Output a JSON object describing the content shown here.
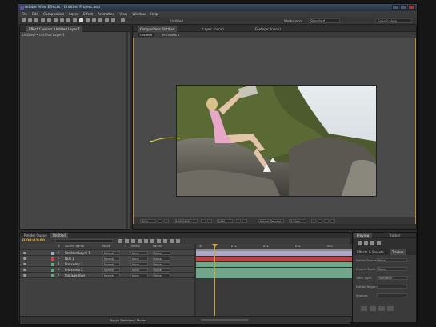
{
  "window": {
    "title": "Adobe After Effects - Untitled Project.aep"
  },
  "menu": [
    "File",
    "Edit",
    "Composition",
    "Layer",
    "Effect",
    "Animation",
    "View",
    "Window",
    "Help"
  ],
  "toolbar": {
    "center_label": "Untitled",
    "workspace_label": "Workspace:",
    "workspace_value": "Standard",
    "search_placeholder": "Search Help"
  },
  "left_panel": {
    "tabs": [
      "Effect Controls: Untitled Layer 1"
    ],
    "subtitle": "Untitled • Untitled Layer 1"
  },
  "comp_panel": {
    "tabs": [
      "Composition: Untitled",
      "Layer: (none)",
      "Footage: (none)"
    ],
    "breadcrumb": [
      "Untitled",
      "Pre-comp 1"
    ],
    "viewer_bar": {
      "zoom": "50%",
      "timecode": "0:00:01:00",
      "resolution": "(Half)",
      "view": "Active Camera",
      "views": "1 View"
    }
  },
  "timeline": {
    "tabs": [
      "Render Queue",
      "Untitled"
    ],
    "timecode": "0:00:01:00",
    "search_placeholder": "",
    "columns": [
      "#",
      "Source Name",
      "Mode",
      "T",
      "TrkMat",
      "Parent"
    ],
    "ruler_ticks": [
      "0s",
      "01s",
      "02s",
      "03s",
      "04s",
      "05s"
    ],
    "footer": "Toggle Switches / Modes",
    "layers": [
      {
        "num": "1",
        "name": "Untitled Layer 1",
        "mode": "Normal",
        "trkmat": "None",
        "parent": "None",
        "color": "#9aa7c9",
        "bar": "#a9a7c5"
      },
      {
        "num": "2",
        "name": "Null 1",
        "mode": "Normal",
        "trkmat": "None",
        "parent": "None",
        "color": "#c94b4b",
        "bar": "#b84343"
      },
      {
        "num": "3",
        "name": "Pre-comp 1",
        "mode": "Normal",
        "trkmat": "None",
        "parent": "None",
        "color": "#6aa58a",
        "bar": "#6da88b"
      },
      {
        "num": "4",
        "name": "Pre-comp 2",
        "mode": "Normal",
        "trkmat": "None",
        "parent": "None",
        "color": "#6aa58a",
        "bar": "#6da88b"
      },
      {
        "num": "5",
        "name": "footage.mov",
        "mode": "Normal",
        "trkmat": "None",
        "parent": "None",
        "color": "#6aa58a",
        "bar": "#6da88b"
      }
    ]
  },
  "right_panel": {
    "tabs": [
      "Preview",
      "Tracker"
    ],
    "subtabs": [
      "Effects & Presets",
      "Tracker"
    ],
    "rows": [
      {
        "label": "Motion Source:",
        "value": "None"
      },
      {
        "label": "Current Track:",
        "value": "None"
      },
      {
        "label": "Track Type:",
        "value": "Transform"
      },
      {
        "label": "Motion Target:",
        "value": ""
      },
      {
        "label": "Analyze:",
        "value": ""
      }
    ]
  },
  "colors": {
    "playhead": "#c9a23a",
    "accent": "#c9a23a"
  }
}
